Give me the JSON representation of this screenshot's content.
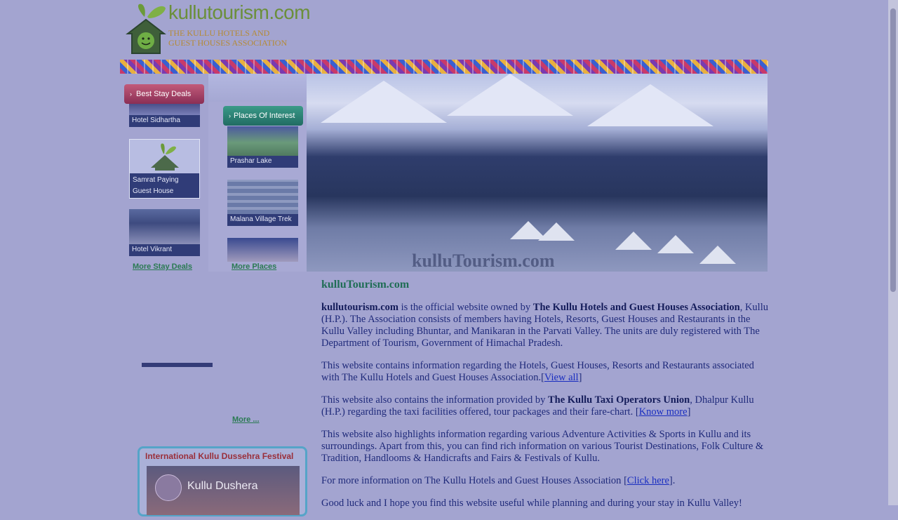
{
  "header": {
    "brand": "kullutourism.com",
    "tagline_line1": "THE KULLU HOTELS AND",
    "tagline_line2": "GUEST HOUSES ASSOCIATION"
  },
  "hero": {
    "watermark": "kulluTourism.com"
  },
  "stay_deals": {
    "button_label": "Best Stay Deals",
    "items": [
      {
        "label": "Hotel Sidhartha"
      },
      {
        "label": "Samrat Paying Guest House"
      },
      {
        "label": "Hotel Vikrant"
      }
    ],
    "more_label": "More Stay Deals"
  },
  "places": {
    "button_label": "Places Of Interest",
    "items": [
      {
        "label": "Prashar Lake"
      },
      {
        "label": "Malana Village Trek"
      }
    ],
    "more_label": "More Places"
  },
  "restaurants": {
    "more_label": "More ..."
  },
  "festival": {
    "title": "International Kullu Dussehra Festival",
    "video_title": "Kullu Dushera"
  },
  "main": {
    "heading": "kulluTourism.com",
    "p1": {
      "site": "kullutourism.com",
      "t1": " is the official website owned by ",
      "assoc": "The Kullu Hotels and Guest Houses Association",
      "t2": ", Kullu (H.P.). The Association consists of members having Hotels, Resorts, Guest Houses and Restaurants in the Kullu Valley including Bhuntar, and Manikaran in the Parvati Valley. The units are duly registered with The Department of Tourism, Government of Himachal Pradesh."
    },
    "p2": {
      "text": "This website contains information regarding the Hotels, Guest Houses, Resorts and Restaurants associated with The Kullu Hotels and Guest Houses Association.",
      "link": "View all"
    },
    "p3": {
      "t1": "This website also contains the information provided by ",
      "union": "The Kullu Taxi Operators Union",
      "t2": ", Dhalpur Kullu (H.P.) regarding the taxi facilities offered, tour packages and their fare-chart. ",
      "link": "Know more"
    },
    "p4": "This website also highlights information regarding various Adventure Activities & Sports in Kullu and its surroundings. Apart from this, you can find rich information on various Tourist Destinations, Folk Culture & Tradition, Handlooms & Handicrafts and Fairs & Festivals of Kullu.",
    "p5": {
      "text": "For more information on The Kullu Hotels and Guest Houses Association ",
      "link": "Click here"
    },
    "p6": "Good luck and I hope you find this website useful while planning and during your stay in Kullu Valley!"
  }
}
